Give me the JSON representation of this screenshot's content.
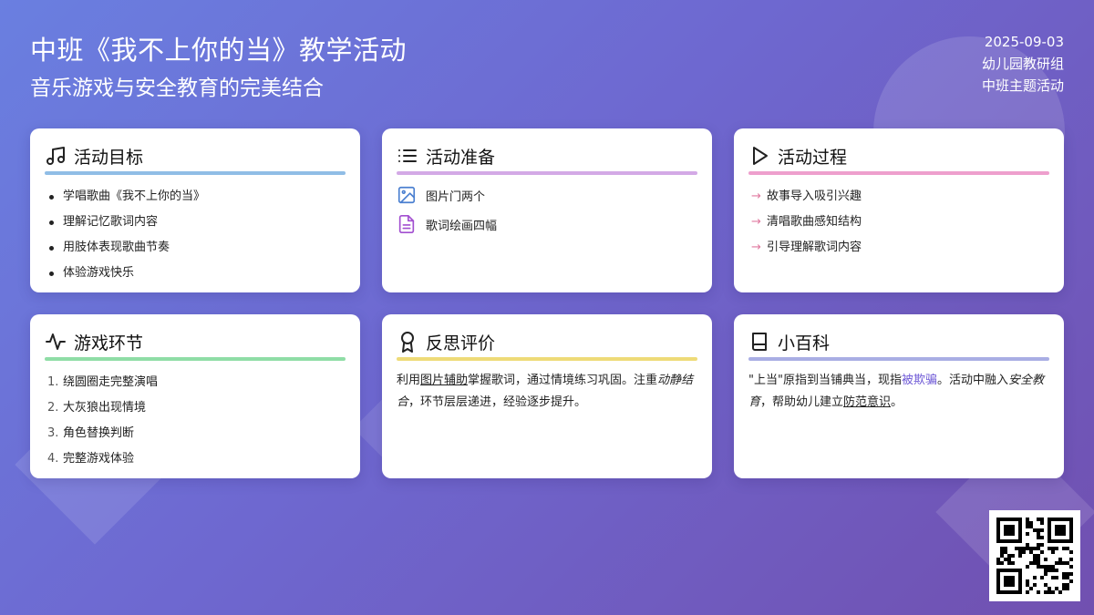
{
  "header": {
    "title": "中班《我不上你的当》教学活动",
    "subtitle": "音乐游戏与安全教育的完美结合"
  },
  "meta": {
    "date": "2025-09-03",
    "group": "幼儿园教研组",
    "category": "中班主题活动"
  },
  "cards": {
    "goals": {
      "title": "活动目标",
      "icon": "music-note-icon",
      "accent": "#90bde6",
      "items": [
        "学唱歌曲《我不上你的当》",
        "理解记忆歌词内容",
        "用肢体表现歌曲节奏",
        "体验游戏快乐"
      ]
    },
    "prep": {
      "title": "活动准备",
      "icon": "list-icon",
      "accent": "#d3a9e6",
      "items": [
        {
          "icon": "image-icon",
          "label": "图片门两个"
        },
        {
          "icon": "document-icon",
          "label": "歌词绘画四幅"
        }
      ]
    },
    "process": {
      "title": "活动过程",
      "icon": "play-icon",
      "accent": "#ee9fcd",
      "arrow": "→",
      "items": [
        "故事导入吸引兴趣",
        "清唱歌曲感知结构",
        "引导理解歌词内容"
      ]
    },
    "game": {
      "title": "游戏环节",
      "icon": "activity-icon",
      "accent": "#8fdda6",
      "items": [
        {
          "num": "1.",
          "label": "绕圆圈走完整演唱"
        },
        {
          "num": "2.",
          "label": "大灰狼出现情境"
        },
        {
          "num": "3.",
          "label": "角色替换判断"
        },
        {
          "num": "4.",
          "label": "完整游戏体验"
        }
      ]
    },
    "reflect": {
      "title": "反思评价",
      "icon": "award-icon",
      "accent": "#eedb78",
      "text": {
        "p1": "利用",
        "p2": "图片辅助",
        "p3": "掌握歌词，通过情境练习巩固。注重",
        "p4": "动静结合",
        "p5": "，环节层层递进，经验逐步提升。"
      }
    },
    "wiki": {
      "title": "小百科",
      "icon": "book-icon",
      "accent": "#a9aee4",
      "text": {
        "p1": "\"上当\"原指到当铺典当，现指",
        "p2": "被欺骗",
        "p3": "。活动中融入",
        "p4": "安全教育",
        "p5": "，帮助幼儿建立",
        "p6": "防范意识",
        "p7": "。"
      }
    }
  },
  "qr": {
    "icon": "qr-code-icon"
  },
  "colors": {
    "bg_start": "#6a7fe0",
    "bg_end": "#7150b0",
    "link_highlight": "#6f5ad6"
  }
}
